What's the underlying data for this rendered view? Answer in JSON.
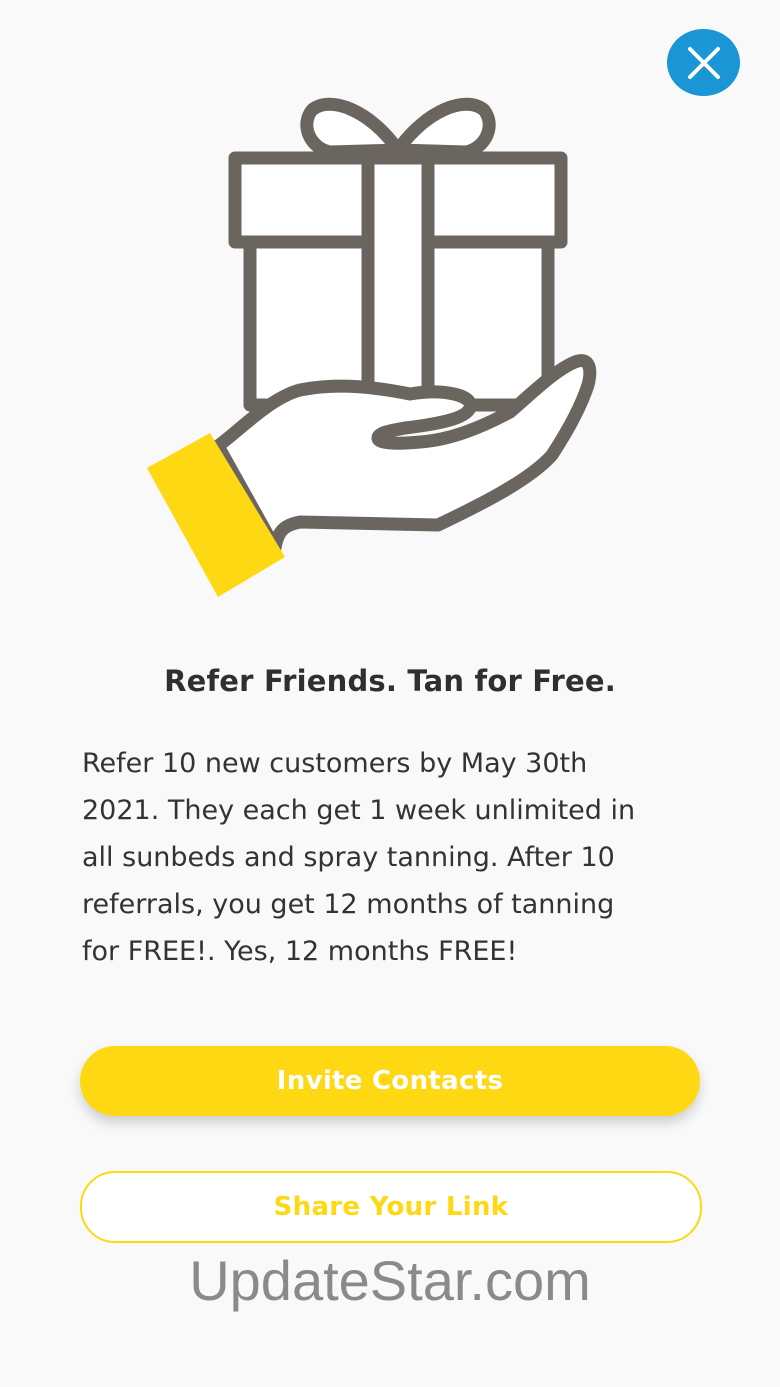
{
  "dialog": {
    "close_icon": "close-icon",
    "illustration_icon": "gift-in-hand-icon",
    "title": "Refer Friends. Tan for Free.",
    "body_lines": [
      "Refer 10 new customers by May 30th",
      "2021. They each get 1 week unlimited in",
      "all sunbeds and spray tanning. After 10",
      "referrals, you get 12 months of tanning",
      "for FREE!. Yes, 12 months FREE!"
    ],
    "invite_label": "Invite Contacts",
    "share_label": "Share Your Link"
  },
  "watermark": "UpdateStar.com",
  "colors": {
    "accent_yellow": "#fed813",
    "close_blue": "#1a95d6",
    "outline_gray": "#6b6560",
    "background": "#f9f9f9"
  }
}
